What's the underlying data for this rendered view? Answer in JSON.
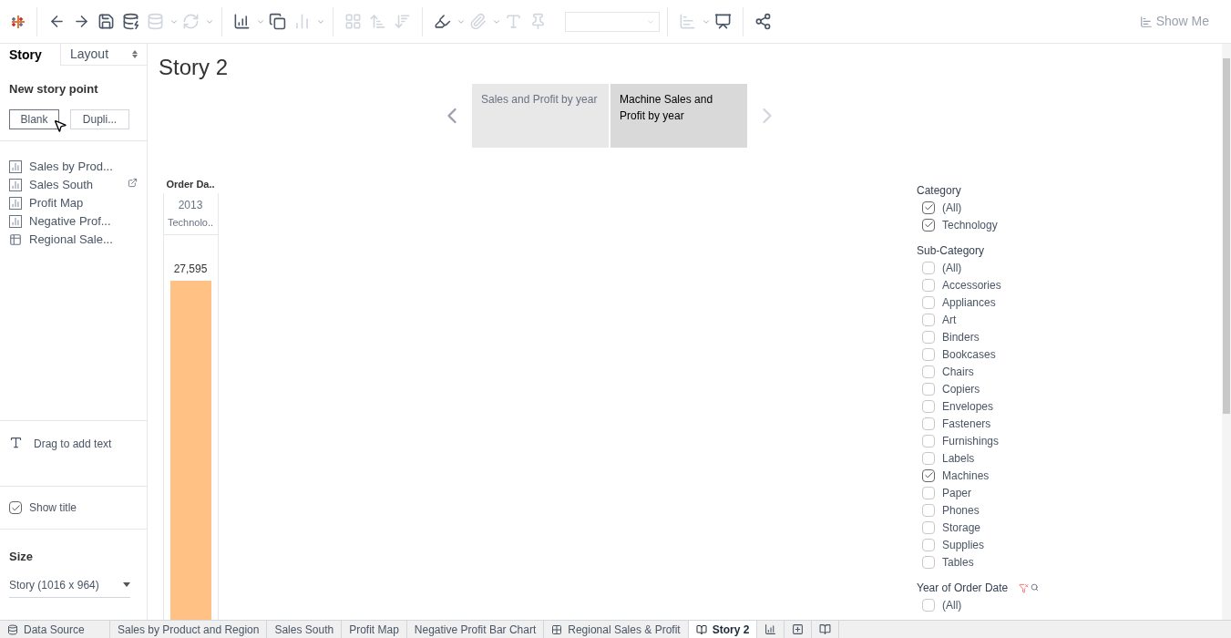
{
  "toolbar": {
    "show_me": "Show Me"
  },
  "side_panel": {
    "tabs": [
      {
        "label": "Story",
        "selected": true
      },
      {
        "label": "Layout",
        "selected": false
      }
    ],
    "new_story_point": {
      "heading": "New story point",
      "buttons": [
        "Blank",
        "Dupli..."
      ]
    },
    "sheets": [
      {
        "label": "Sales by Prod...",
        "kind": "chart",
        "linked": false
      },
      {
        "label": "Sales South",
        "kind": "chart",
        "linked": true
      },
      {
        "label": "Profit Map",
        "kind": "chart",
        "linked": false
      },
      {
        "label": "Negative Prof...",
        "kind": "chart",
        "linked": false
      },
      {
        "label": "Regional Sale...",
        "kind": "table",
        "linked": false
      }
    ],
    "drag_text": "Drag to add text",
    "show_title": {
      "label": "Show title",
      "checked": true
    },
    "size": {
      "heading": "Size",
      "value": "Story (1016 x 964)"
    }
  },
  "story": {
    "title": "Story 2",
    "points": [
      {
        "label": "Sales and Profit by year",
        "selected": false
      },
      {
        "label": "Machine Sales and Profit by year",
        "selected": true
      }
    ],
    "view": {
      "header": "Order Da..",
      "year": "2013",
      "category": "Technolo..",
      "value_label": "27,595"
    }
  },
  "filters": [
    {
      "title": "Category",
      "items": [
        {
          "label": "(All)",
          "checked": true
        },
        {
          "label": "Technology",
          "checked": true
        }
      ]
    },
    {
      "title": "Sub-Category",
      "items": [
        {
          "label": "(All)",
          "checked": false
        },
        {
          "label": "Accessories",
          "checked": false
        },
        {
          "label": "Appliances",
          "checked": false
        },
        {
          "label": "Art",
          "checked": false
        },
        {
          "label": "Binders",
          "checked": false
        },
        {
          "label": "Bookcases",
          "checked": false
        },
        {
          "label": "Chairs",
          "checked": false
        },
        {
          "label": "Copiers",
          "checked": false
        },
        {
          "label": "Envelopes",
          "checked": false
        },
        {
          "label": "Fasteners",
          "checked": false
        },
        {
          "label": "Furnishings",
          "checked": false
        },
        {
          "label": "Labels",
          "checked": false
        },
        {
          "label": "Machines",
          "checked": true
        },
        {
          "label": "Paper",
          "checked": false
        },
        {
          "label": "Phones",
          "checked": false
        },
        {
          "label": "Storage",
          "checked": false
        },
        {
          "label": "Supplies",
          "checked": false
        },
        {
          "label": "Tables",
          "checked": false
        }
      ]
    },
    {
      "title": "Year of Order Date",
      "items": [
        {
          "label": "(All)",
          "checked": false
        }
      ]
    }
  ],
  "sheet_tabs": [
    {
      "label": "Data Source",
      "kind": "datasource",
      "selected": false
    },
    {
      "label": "Sales by Product and Region",
      "kind": "sheet",
      "selected": false
    },
    {
      "label": "Sales South",
      "kind": "sheet",
      "selected": false
    },
    {
      "label": "Profit Map",
      "kind": "sheet",
      "selected": false
    },
    {
      "label": "Negative Profit Bar Chart",
      "kind": "sheet",
      "selected": false
    },
    {
      "label": "Regional Sales & Profit",
      "kind": "dashboard",
      "selected": false
    },
    {
      "label": "Story 2",
      "kind": "story",
      "selected": true
    }
  ]
}
